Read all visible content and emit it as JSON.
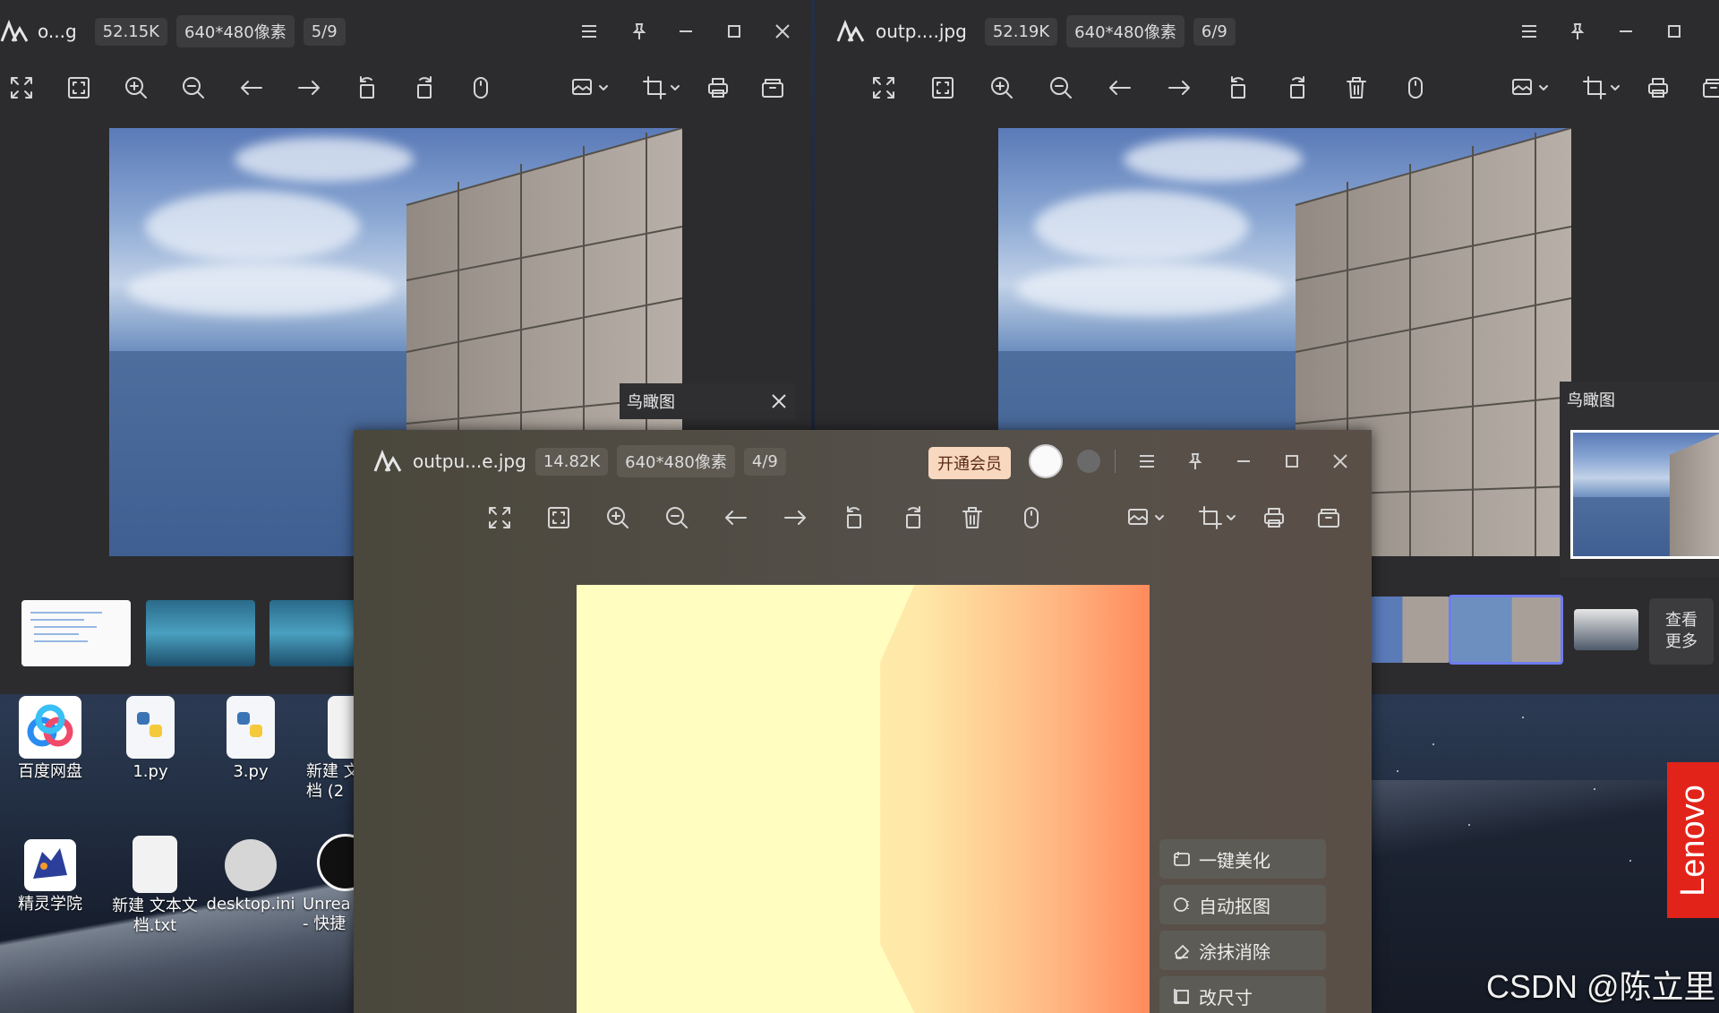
{
  "desktop": {
    "icons_row1": [
      {
        "label": "百度网盘",
        "icon": "baidu-netdisk-icon"
      },
      {
        "label": "1.py",
        "icon": "python-file-icon"
      },
      {
        "label": "3.py",
        "icon": "python-file-icon"
      },
      {
        "label": "新建 文\n档 (2",
        "icon": "text-file-icon"
      }
    ],
    "icons_row2": [
      {
        "label": "精灵学院",
        "icon": "sprite-academy-icon"
      },
      {
        "label": "新建 文本文\n档.txt",
        "icon": "text-file-icon"
      },
      {
        "label": "desktop.ini",
        "icon": "ini-file-icon"
      },
      {
        "label": "Unrea\n- 快捷",
        "icon": "unreal-engine-icon"
      }
    ],
    "brand": "Lenovo",
    "watermark": "CSDN @陈立里"
  },
  "window_left": {
    "filename": "o...g",
    "size": "52.15K",
    "dimensions": "640*480像素",
    "index": "5/9",
    "overview_title": "鸟瞰图"
  },
  "window_right": {
    "filename": "outp....jpg",
    "size": "52.19K",
    "dimensions": "640*480像素",
    "index": "6/9",
    "overview_title": "鸟瞰图",
    "see_more": "查看\n更多"
  },
  "window_front": {
    "filename": "outpu...e.jpg",
    "size": "14.82K",
    "dimensions": "640*480像素",
    "index": "4/9",
    "vip_label": "开通会员",
    "actions": [
      {
        "label": "一键美化",
        "icon": "beautify-icon"
      },
      {
        "label": "自动抠图",
        "icon": "cutout-icon"
      },
      {
        "label": "涂抹消除",
        "icon": "eraser-icon"
      },
      {
        "label": "改尺寸",
        "icon": "resize-icon"
      }
    ]
  },
  "colors": {
    "window_dark": "#2c2c2e",
    "vip_bg": "#f9d8c0",
    "lenovo_red": "#e2231a",
    "thumb_selected": "#6f7cf0"
  }
}
